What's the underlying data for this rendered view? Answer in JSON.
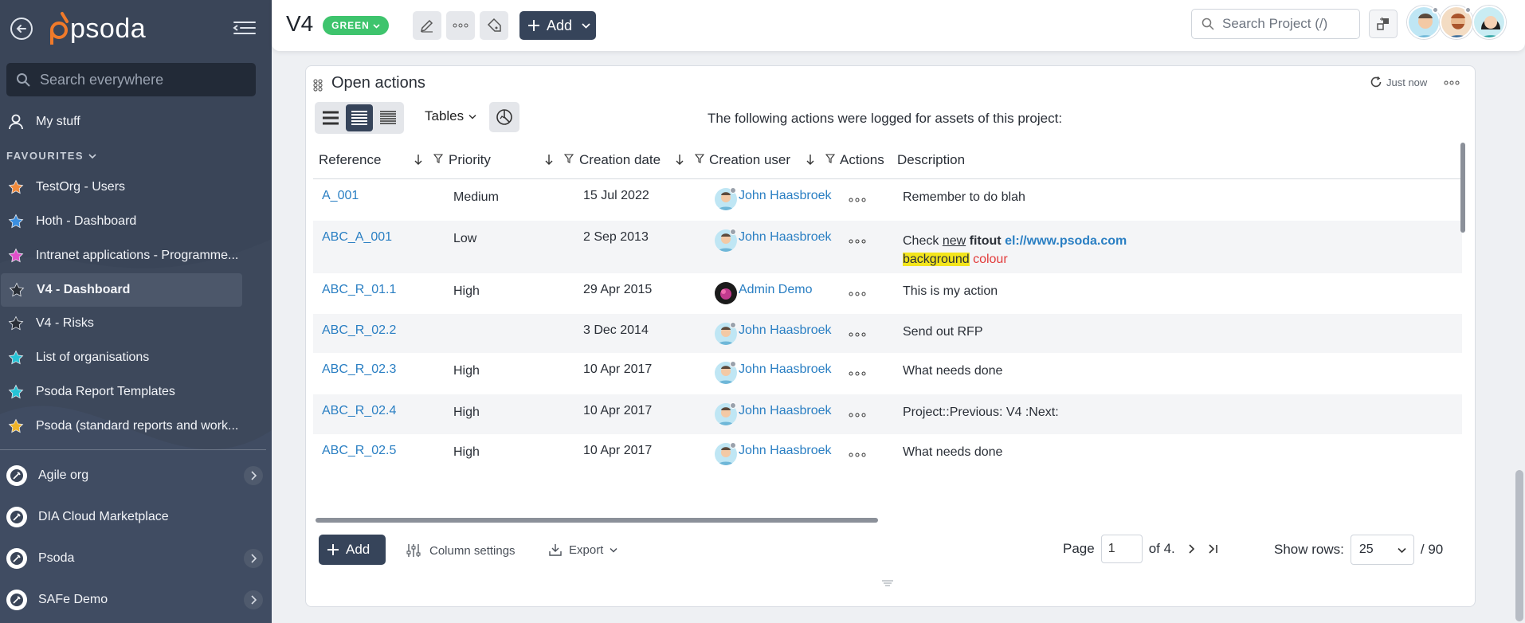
{
  "sidebar": {
    "logo_text": "psoda",
    "search_placeholder": "Search everywhere",
    "my_stuff": "My stuff",
    "favourites_header": "FAVOURITES",
    "favourites": [
      {
        "label": "TestOrg - Users",
        "star_color": "#f08a3c"
      },
      {
        "label": "Hoth - Dashboard",
        "star_color": "#3b8fe0"
      },
      {
        "label": "Intranet applications - Programme...",
        "star_color": "#e04fc9"
      },
      {
        "label": "V4 - Dashboard",
        "star_color": "#2a2f37"
      },
      {
        "label": "V4 - Risks",
        "star_color": "#2a2f37"
      },
      {
        "label": "List of organisations",
        "star_color": "#27c3d6"
      },
      {
        "label": "Psoda Report Templates",
        "star_color": "#27c3d6"
      },
      {
        "label": "Psoda (standard reports and work...",
        "star_color": "#f0b429"
      }
    ],
    "organisations": [
      {
        "label": "Agile org",
        "has_chevron": true
      },
      {
        "label": "DIA Cloud Marketplace",
        "has_chevron": false
      },
      {
        "label": "Psoda",
        "has_chevron": true
      },
      {
        "label": "SAFe Demo",
        "has_chevron": true
      }
    ]
  },
  "topbar": {
    "project_title": "V4",
    "status": "GREEN",
    "add_label": "Add",
    "search_placeholder": "Search Project (/)"
  },
  "panel": {
    "title": "Open actions",
    "refreshed": "Just now",
    "view_dropdown": "Tables",
    "intro": "The following actions were logged for assets of this project:",
    "columns": [
      "Reference",
      "Priority",
      "Creation date",
      "Creation user",
      "Actions",
      "Description"
    ],
    "rows": [
      {
        "reference": "A_001",
        "priority": "Medium",
        "date": "15 Jul 2022",
        "user": "John Haasbroek",
        "desc": "Remember to do blah"
      },
      {
        "reference": "ABC_A_001",
        "priority": "Low",
        "date": "2 Sep 2013",
        "user": "John Haasbroek",
        "desc_parts": [
          "Check",
          "new",
          "fitout",
          "el://www.psoda.com",
          "background",
          "colour"
        ]
      },
      {
        "reference": "ABC_R_01.1",
        "priority": "High",
        "date": "29 Apr 2015",
        "user": "Admin Demo",
        "desc": "This is my action"
      },
      {
        "reference": "ABC_R_02.2",
        "priority": "",
        "date": "3 Dec 2014",
        "user": "John Haasbroek",
        "desc": "Send out RFP"
      },
      {
        "reference": "ABC_R_02.3",
        "priority": "High",
        "date": "10 Apr 2017",
        "user": "John Haasbroek",
        "desc": "What needs done"
      },
      {
        "reference": "ABC_R_02.4",
        "priority": "High",
        "date": "10 Apr 2017",
        "user": "John Haasbroek",
        "desc": "Project::Previous: V4 :Next:"
      },
      {
        "reference": "ABC_R_02.5",
        "priority": "High",
        "date": "10 Apr 2017",
        "user": "John Haasbroek",
        "desc": "What needs done"
      }
    ],
    "footer": {
      "add_label": "Add",
      "column_settings": "Column settings",
      "export": "Export",
      "page_label": "Page",
      "page_value": "1",
      "page_of": "of 4.",
      "show_rows_label": "Show rows:",
      "rows_value": "25",
      "total": "/ 90"
    }
  },
  "colors": {
    "sidebar_bg": "#3a4558",
    "accent_dark": "#36445a",
    "status_green": "#3ec46d",
    "link_blue": "#2a7fc3",
    "logo_orange": "#f07a2a"
  }
}
